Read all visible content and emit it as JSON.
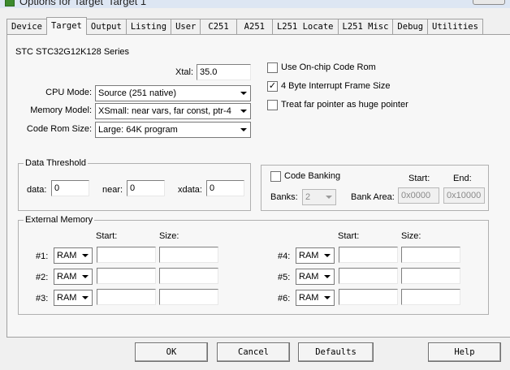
{
  "window": {
    "title": "Options for Target 'Target 1'"
  },
  "tabs": [
    "Device",
    "Target",
    "Output",
    "Listing",
    "User",
    "C251",
    "A251",
    "L251 Locate",
    "L251 Misc",
    "Debug",
    "Utilities"
  ],
  "active_tab": "Target",
  "target": {
    "series": "STC STC32G12K128 Series",
    "xtal_label": "Xtal:",
    "xtal_value": "35.0",
    "cpu_mode_label": "CPU Mode:",
    "cpu_mode_value": "Source (251 native)",
    "memory_model_label": "Memory Model:",
    "memory_model_value": "XSmall: near vars, far const, ptr-4",
    "code_rom_label": "Code Rom Size:",
    "code_rom_value": "Large: 64K program",
    "checkboxes": [
      {
        "label": "Use On-chip Code Rom",
        "checked": false
      },
      {
        "label": "4 Byte Interrupt Frame Size",
        "checked": true
      },
      {
        "label": "Treat far pointer as huge pointer",
        "checked": false
      }
    ],
    "check_mark": "✓"
  },
  "data_threshold": {
    "title": "Data Threshold",
    "data_label": "data:",
    "data_value": "0",
    "near_label": "near:",
    "near_value": "0",
    "xdata_label": "xdata:",
    "xdata_value": "0"
  },
  "code_banking": {
    "label": "Code Banking",
    "checked": false,
    "banks_label": "Banks:",
    "banks_value": "2",
    "bank_area_label": "Bank Area:",
    "start_label": "Start:",
    "end_label": "End:",
    "start_value": "0x0000",
    "end_value": "0x10000"
  },
  "external_memory": {
    "title": "External Memory",
    "start_label": "Start:",
    "size_label": "Size:",
    "rows": [
      {
        "id": "#1:",
        "type": "RAM",
        "start": "",
        "size": ""
      },
      {
        "id": "#2:",
        "type": "RAM",
        "start": "",
        "size": ""
      },
      {
        "id": "#3:",
        "type": "RAM",
        "start": "",
        "size": ""
      },
      {
        "id": "#4:",
        "type": "RAM",
        "start": "",
        "size": ""
      },
      {
        "id": "#5:",
        "type": "RAM",
        "start": "",
        "size": ""
      },
      {
        "id": "#6:",
        "type": "RAM",
        "start": "",
        "size": ""
      }
    ]
  },
  "buttons": {
    "ok": "OK",
    "cancel": "Cancel",
    "defaults": "Defaults",
    "help": "Help"
  }
}
